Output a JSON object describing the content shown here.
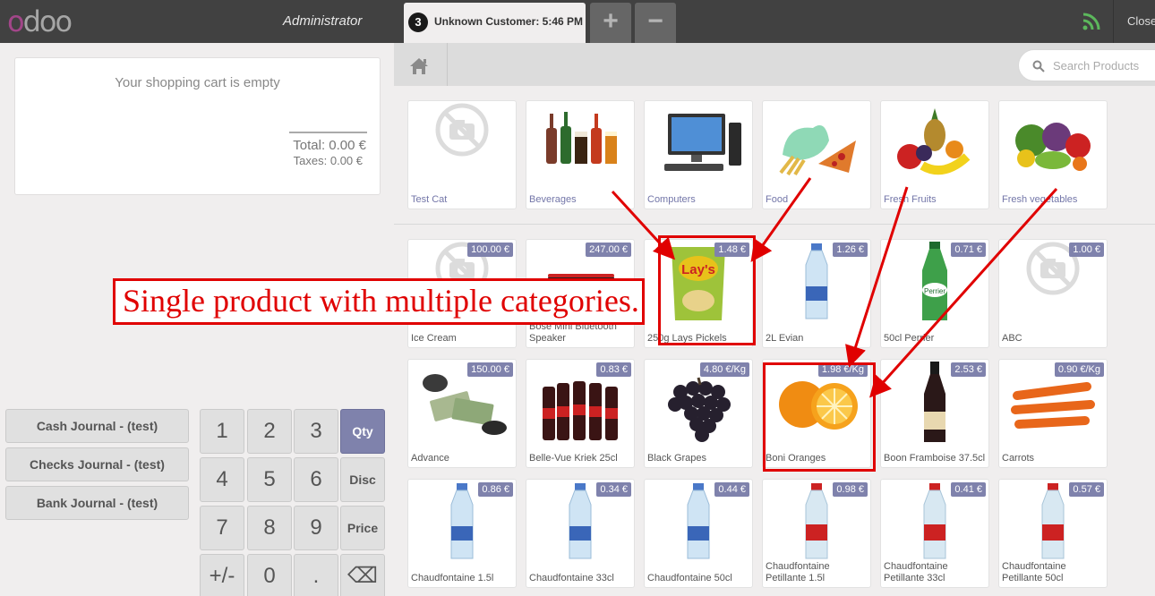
{
  "app": {
    "logo": "odoo",
    "user": "Administrator"
  },
  "order": {
    "number": "3",
    "label": "Unknown Customer: 5:46 PM"
  },
  "toolbar": {
    "add": "+",
    "remove": "−",
    "close": "Close"
  },
  "cart": {
    "empty_text": "Your shopping cart is empty",
    "total": "Total: 0.00 €",
    "taxes": "Taxes: 0.00 €"
  },
  "search": {
    "placeholder": "Search Products"
  },
  "journals": [
    "Cash Journal - (test)",
    "Checks Journal - (test)",
    "Bank Journal - (test)"
  ],
  "numpad": [
    "1",
    "2",
    "3",
    "Qty",
    "4",
    "5",
    "6",
    "Disc",
    "7",
    "8",
    "9",
    "Price",
    "+/-",
    "0",
    ".",
    "⌫"
  ],
  "categories": [
    {
      "name": "Test Cat",
      "icon": "no-image-icon"
    },
    {
      "name": "Beverages",
      "icon": "bottles-icon"
    },
    {
      "name": "Computers",
      "icon": "computer-icon"
    },
    {
      "name": "Food",
      "icon": "food-icon"
    },
    {
      "name": "Fresh Fruits",
      "icon": "fruits-icon"
    },
    {
      "name": "Fresh vegetables",
      "icon": "vegetables-icon"
    }
  ],
  "products": [
    {
      "name": "Ice Cream",
      "price": "100.00 €",
      "icon": "no-image-icon"
    },
    {
      "name": "Bose Mini Bluetooth Speaker",
      "price": "247.00 €",
      "icon": "speaker-icon"
    },
    {
      "name": "250g Lays Pickels",
      "price": "1.48 €",
      "icon": "chips-icon"
    },
    {
      "name": "2L Evian",
      "price": "1.26 €",
      "icon": "water-bottle-icon"
    },
    {
      "name": "50cl Perrier",
      "price": "0.71 €",
      "icon": "green-bottle-icon"
    },
    {
      "name": "ABC",
      "price": "1.00 €",
      "icon": "no-image-icon"
    },
    {
      "name": "Advance",
      "price": "150.00 €",
      "icon": "money-icon"
    },
    {
      "name": "Belle-Vue Kriek 25cl",
      "price": "0.83 €",
      "icon": "beer-bottles-icon"
    },
    {
      "name": "Black Grapes",
      "price": "4.80 €/Kg",
      "icon": "grapes-icon"
    },
    {
      "name": "Boni Oranges",
      "price": "1.98 €/Kg",
      "icon": "oranges-icon"
    },
    {
      "name": "Boon Framboise 37.5cl",
      "price": "2.53 €",
      "icon": "dark-bottle-icon"
    },
    {
      "name": "Carrots",
      "price": "0.90 €/Kg",
      "icon": "carrots-icon"
    },
    {
      "name": "Chaudfontaine 1.5l",
      "price": "0.86 €",
      "icon": "water-bottle-icon"
    },
    {
      "name": "Chaudfontaine 33cl",
      "price": "0.34 €",
      "icon": "water-bottle-icon"
    },
    {
      "name": "Chaudfontaine 50cl",
      "price": "0.44 €",
      "icon": "water-bottle-icon"
    },
    {
      "name": "Chaudfontaine Petillante 1.5l",
      "price": "0.98 €",
      "icon": "sparkling-bottle-icon"
    },
    {
      "name": "Chaudfontaine Petillante 33cl",
      "price": "0.41 €",
      "icon": "sparkling-bottle-icon"
    },
    {
      "name": "Chaudfontaine Petillante 50cl",
      "price": "0.57 €",
      "icon": "sparkling-bottle-icon"
    }
  ],
  "annotation": {
    "text": "Single product with multiple categories."
  },
  "colors": {
    "topbar": "#414141",
    "accent": "#7f82ac",
    "annotation": "#e00000"
  }
}
